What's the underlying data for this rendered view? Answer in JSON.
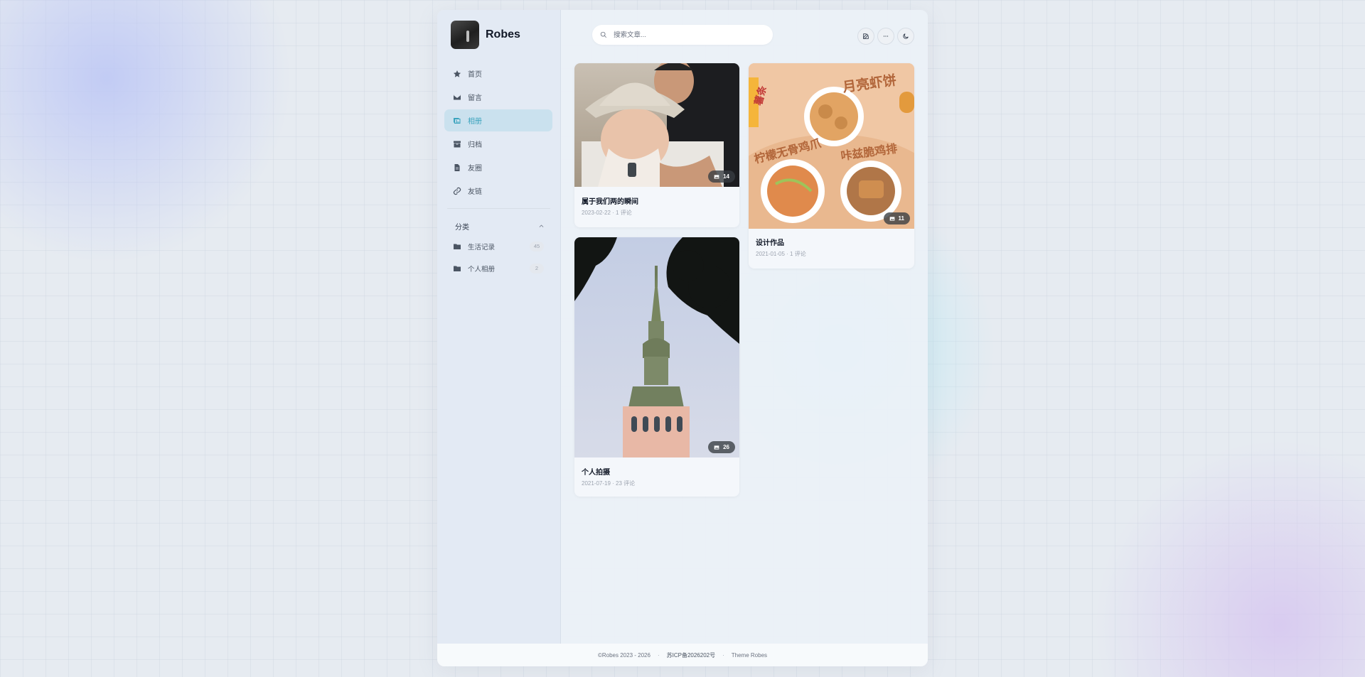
{
  "brand": {
    "name": "Robes"
  },
  "search": {
    "placeholder": "搜索文章..."
  },
  "toolbar": {
    "edit_icon": "edit-icon",
    "more_icon": "more-icon",
    "theme_icon": "moon-icon"
  },
  "nav": [
    {
      "label": "首页",
      "icon": "star-icon",
      "active": false
    },
    {
      "label": "留言",
      "icon": "envelope-icon",
      "active": false
    },
    {
      "label": "相册",
      "icon": "images-icon",
      "active": true
    },
    {
      "label": "归档",
      "icon": "archive-icon",
      "active": false
    },
    {
      "label": "友圈",
      "icon": "file-icon",
      "active": false
    },
    {
      "label": "友链",
      "icon": "link-icon",
      "active": false
    }
  ],
  "categories": {
    "header": "分类",
    "items": [
      {
        "label": "生活记录",
        "count": "45"
      },
      {
        "label": "个人相册",
        "count": "2"
      }
    ]
  },
  "cards": [
    {
      "title": "属于我们两的瞬间",
      "meta": "2023-02-22 · 1 评论",
      "count": "14"
    },
    {
      "title": "设计作品",
      "meta": "2021-01-05 · 1 评论",
      "count": "11"
    },
    {
      "title": "个人拍摄",
      "meta": "2021-07-19 · 23 评论",
      "count": "26"
    }
  ],
  "poster_text": {
    "left": "薯条",
    "top": "月亮虾饼",
    "mid_left": "柠檬无骨鸡爪",
    "mid_right": "咔兹脆鸡排"
  },
  "footer": {
    "copyright": "©Robes 2023 - 2026",
    "icp": "苏ICP备2026202号",
    "theme": "Theme Robes"
  },
  "colors": {
    "accent": "#3aa3bd",
    "active_bg": "#cfe6ee"
  }
}
